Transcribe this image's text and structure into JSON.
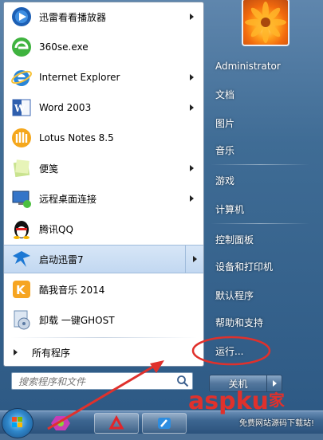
{
  "left_programs": [
    {
      "label": "迅雷看看播放器",
      "icon": "xunlei-kankan-icon",
      "has_submenu": true
    },
    {
      "label": "360se.exe",
      "icon": "360-browser-icon",
      "has_submenu": false
    },
    {
      "label": "Internet Explorer",
      "icon": "internet-explorer-icon",
      "has_submenu": true
    },
    {
      "label": "Word 2003",
      "icon": "word-icon",
      "has_submenu": true
    },
    {
      "label": "Lotus Notes 8.5",
      "icon": "lotus-notes-icon",
      "has_submenu": false
    },
    {
      "label": "便笺",
      "icon": "sticky-notes-icon",
      "has_submenu": true
    },
    {
      "label": "远程桌面连接",
      "icon": "remote-desktop-icon",
      "has_submenu": true
    },
    {
      "label": "腾讯QQ",
      "icon": "qq-penguin-icon",
      "has_submenu": false
    },
    {
      "label": "启动迅雷7",
      "icon": "thunder-bird-icon",
      "has_submenu": true,
      "highlighted": true
    },
    {
      "label": "酷我音乐 2014",
      "icon": "kuwo-music-icon",
      "has_submenu": false
    },
    {
      "label": "卸载 一键GHOST",
      "icon": "ghost-uninstall-icon",
      "has_submenu": false
    }
  ],
  "all_programs_label": "所有程序",
  "search": {
    "placeholder": "搜索程序和文件"
  },
  "right_items": [
    {
      "label": "Administrator"
    },
    {
      "label": "文档"
    },
    {
      "label": "图片"
    },
    {
      "label": "音乐"
    },
    {
      "label": "游戏"
    },
    {
      "label": "计算机"
    },
    {
      "label": "控制面板"
    },
    {
      "label": "设备和打印机"
    },
    {
      "label": "默认程序"
    },
    {
      "label": "帮助和支持"
    },
    {
      "label": "运行..."
    }
  ],
  "shutdown_label": "关机",
  "watermark": {
    "text": "aspku",
    "glyph": "家",
    "sub": "免费网站源码下载站!"
  },
  "colors": {
    "annotation_red": "#e0312c",
    "highlight_blue": "#c2d8f1"
  }
}
